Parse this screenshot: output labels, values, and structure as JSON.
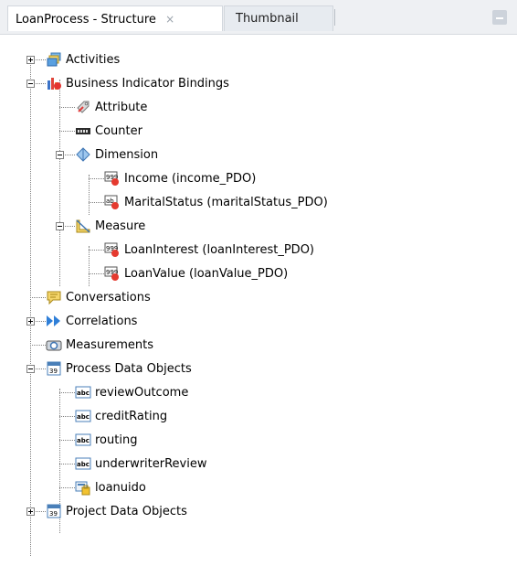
{
  "tabs": {
    "active_label": "LoanProcess - Structure",
    "active_close": "×",
    "inactive_label": "Thumbnail"
  },
  "tree": {
    "activities": "Activities",
    "business_indicator_bindings": "Business Indicator Bindings",
    "attribute": "Attribute",
    "counter": "Counter",
    "dimension": "Dimension",
    "income": "Income (income_PDO)",
    "marital_status": "MaritalStatus (maritalStatus_PDO)",
    "measure": "Measure",
    "loan_interest": "LoanInterest (loanInterest_PDO)",
    "loan_value": "LoanValue (loanValue_PDO)",
    "conversations": "Conversations",
    "correlations": "Correlations",
    "measurements": "Measurements",
    "process_data_objects": "Process Data Objects",
    "review_outcome": "reviewOutcome",
    "credit_rating": "creditRating",
    "routing": "routing",
    "underwriter_review": "underwriterReview",
    "loanuido": "loanuido",
    "project_data_objects": "Project Data Objects"
  },
  "icons": {
    "activities": "activities-icon",
    "business_indicator_bindings": "bi-bindings-icon",
    "attribute": "attribute-icon",
    "counter": "counter-icon",
    "dimension": "dimension-icon",
    "measure": "measure-icon",
    "pdo_numeric": "numeric-pdo-icon",
    "pdo_string": "string-pdo-icon",
    "conversations": "conversation-icon",
    "correlations": "correlation-icon",
    "measurements": "measurement-icon",
    "data_objects": "data-objects-icon",
    "abc": "abc-icon",
    "ui_object": "ui-object-icon"
  },
  "colors": {
    "tab_bar": "#eef0f3",
    "active_tab": "#ffffff",
    "tree_line": "#808080"
  }
}
